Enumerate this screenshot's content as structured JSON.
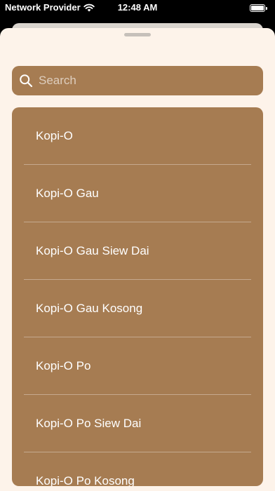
{
  "status_bar": {
    "carrier": "Network Provider",
    "time": "12:48 AM"
  },
  "search": {
    "placeholder": "Search",
    "value": ""
  },
  "drinks": [
    "Kopi-O",
    "Kopi-O Gau",
    "Kopi-O Gau Siew Dai",
    "Kopi-O Gau Kosong",
    "Kopi-O Po",
    "Kopi-O Po Siew Dai",
    "Kopi-O Po Kosong"
  ],
  "colors": {
    "sheet_background": "#fdf3ea",
    "accent_brown": "#a67c52",
    "text": "#ffffff"
  },
  "icons": {
    "search": "search-icon",
    "wifi": "wifi-icon",
    "battery": "battery-icon"
  }
}
